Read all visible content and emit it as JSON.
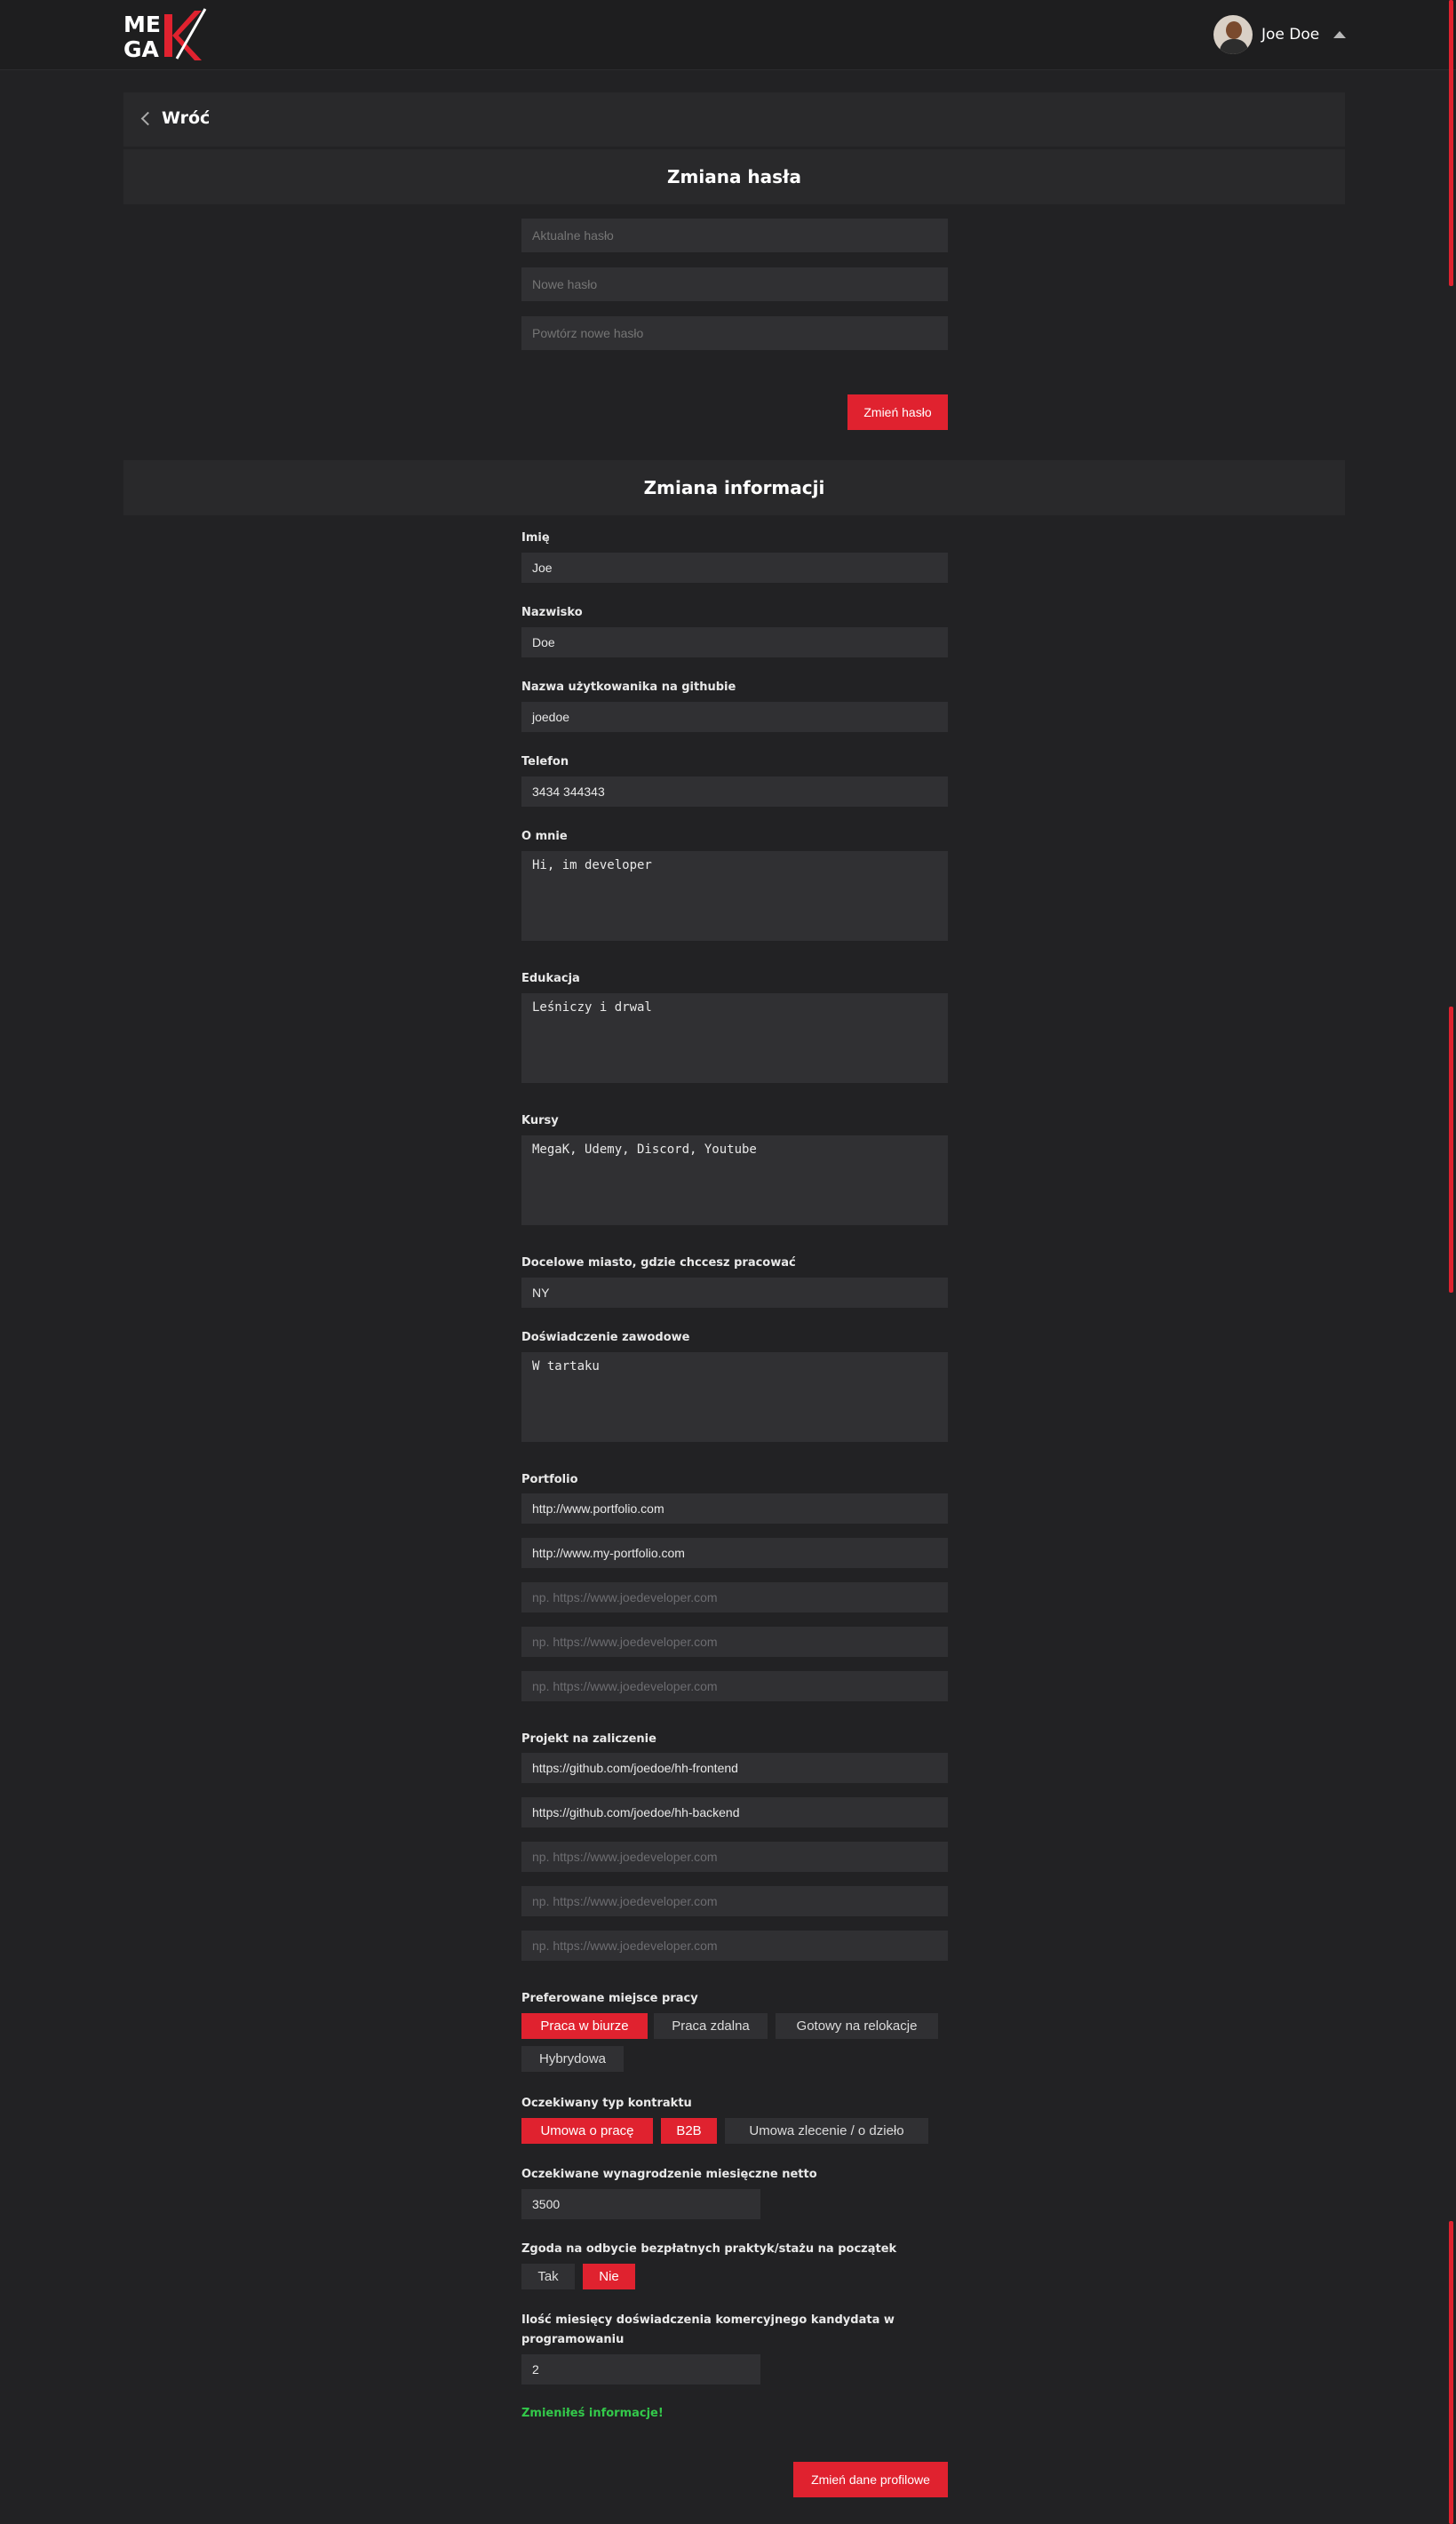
{
  "header": {
    "logo_text": "MEGAK",
    "user_name": "Joe Doe",
    "brand_color": "#e0222f"
  },
  "back": {
    "label": "Wróć"
  },
  "password": {
    "title": "Zmiana hasła",
    "current_placeholder": "Aktualne hasło",
    "new_placeholder": "Nowe hasło",
    "repeat_placeholder": "Powtórz nowe hasło",
    "submit_label": "Zmień hasło"
  },
  "info": {
    "title": "Zmiana informacji",
    "first_name": {
      "label": "Imię",
      "value": "Joe"
    },
    "last_name": {
      "label": "Nazwisko",
      "value": "Doe"
    },
    "github": {
      "label": "Nazwa użytkowanika na githubie",
      "value": "joedoe"
    },
    "phone": {
      "label": "Telefon",
      "value": "3434 344343"
    },
    "bio": {
      "label": "O mnie",
      "value": "Hi, im developer"
    },
    "education": {
      "label": "Edukacja",
      "value": "Leśniczy i drwal"
    },
    "courses": {
      "label": "Kursy",
      "value": "MegaK, Udemy, Discord, Youtube"
    },
    "target_city": {
      "label": "Docelowe miasto, gdzie chccesz pracować",
      "value": "NY"
    },
    "experience": {
      "label": "Doświadczenie zawodowe",
      "value": "W tartaku"
    },
    "portfolio": {
      "label": "Portfolio",
      "placeholder": "np. https://www.joedeveloper.com",
      "values": [
        "http://www.portfolio.com",
        "http://www.my-portfolio.com",
        "",
        "",
        ""
      ]
    },
    "project": {
      "label": "Projekt na zaliczenie",
      "placeholder": "np. https://www.joedeveloper.com",
      "values": [
        "https://github.com/joedoe/hh-frontend",
        "https://github.com/joedoe/hh-backend",
        "",
        "",
        ""
      ]
    },
    "workplace": {
      "label": "Preferowane miejsce pracy",
      "options": [
        {
          "label": "Praca w biurze",
          "selected": true
        },
        {
          "label": "Praca zdalna",
          "selected": false
        },
        {
          "label": "Gotowy na relokacje",
          "selected": false
        },
        {
          "label": "Hybrydowa",
          "selected": false
        }
      ]
    },
    "contract": {
      "label": "Oczekiwany typ kontraktu",
      "options": [
        {
          "label": "Umowa o pracę",
          "selected": true
        },
        {
          "label": "B2B",
          "selected": true
        },
        {
          "label": "Umowa zlecenie / o dzieło",
          "selected": false
        }
      ]
    },
    "salary": {
      "label": "Oczekiwane wynagrodzenie miesięczne netto",
      "value": "3500"
    },
    "internship": {
      "label": "Zgoda na odbycie bezpłatnych praktyk/stażu na początek",
      "options": [
        {
          "label": "Tak",
          "selected": false
        },
        {
          "label": "Nie",
          "selected": true
        }
      ]
    },
    "months_experience": {
      "label_line1": "Ilość miesięcy doświadczenia komercyjnego kandydata w",
      "label_line2": "programowaniu",
      "value": "2"
    },
    "success_message": "Zmieniłeś informacje!",
    "submit_label": "Zmień dane profilowe"
  }
}
